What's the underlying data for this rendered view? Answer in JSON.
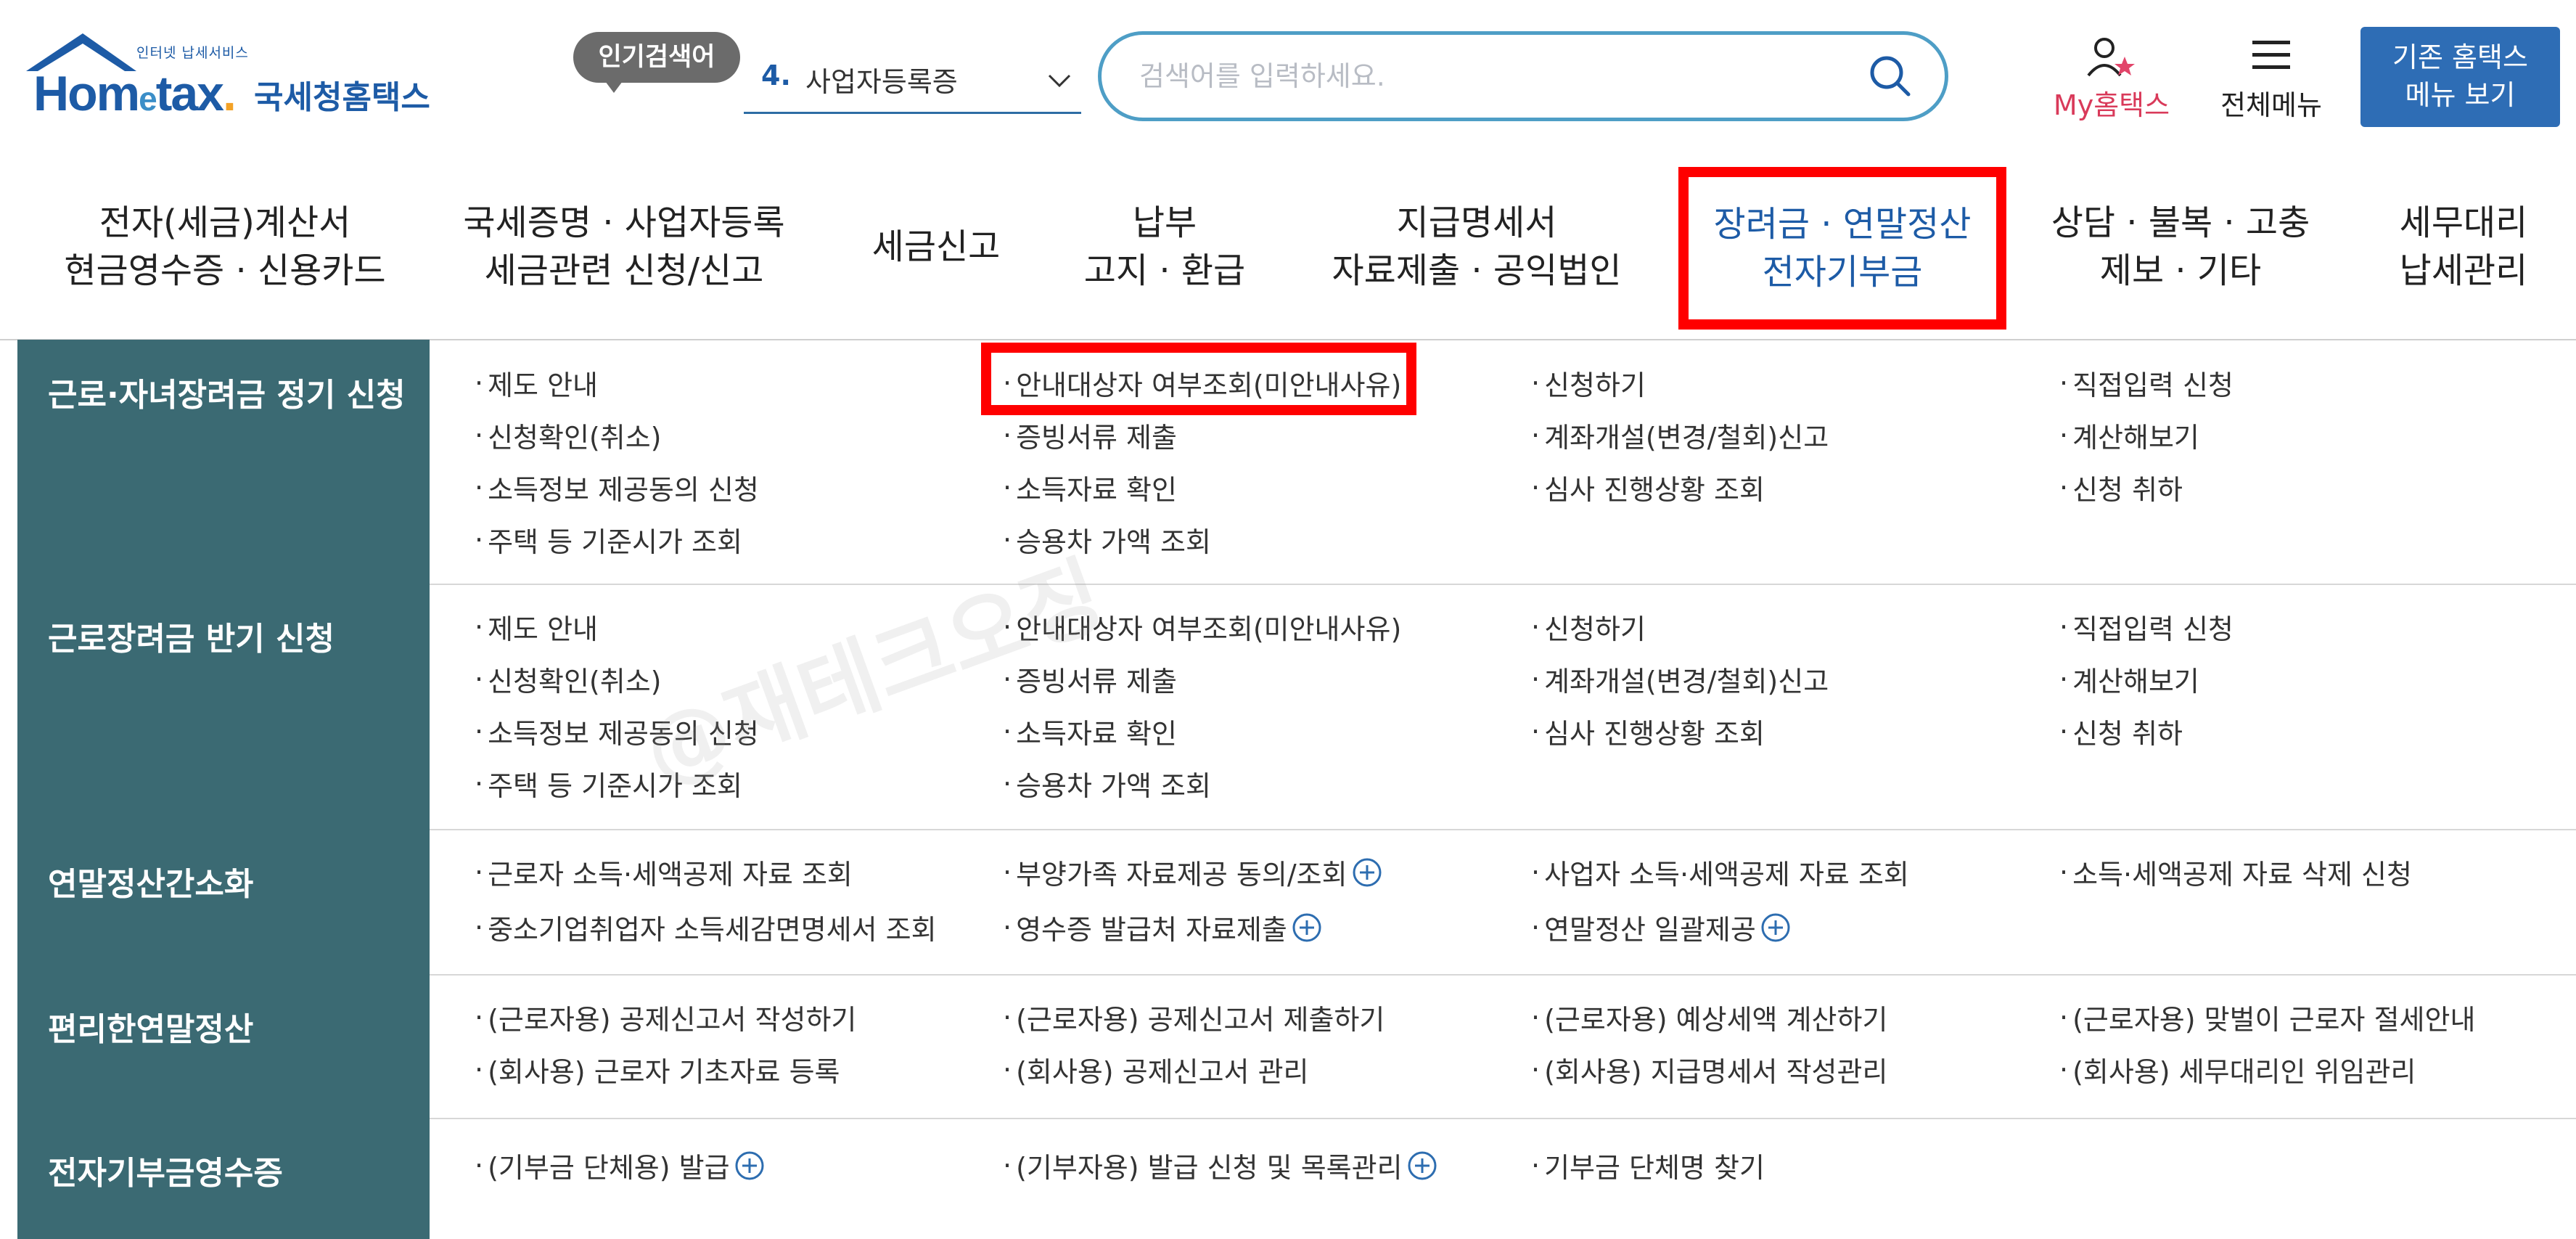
{
  "logo": {
    "tagline": "인터넷 납세서비스",
    "home_text": "Hom",
    "e_text": "e",
    "tax_text": "tax",
    "dot": ".",
    "service_name": "국세청홈택스"
  },
  "header": {
    "popular_badge": "인기검색어",
    "popular_rank": "4.",
    "popular_term": "사업자등록증",
    "search_placeholder": "검색어를 입력하세요.",
    "my_hometax": "My홈택스",
    "all_menu": "전체메뉴",
    "old_hometax_line1": "기존 홈택스",
    "old_hometax_line2": "메뉴 보기"
  },
  "nav": [
    {
      "line1": "전자(세금)계산서",
      "line2": "현금영수증 · 신용카드"
    },
    {
      "line1": "국세증명 · 사업자등록",
      "line2": "세금관련 신청/신고"
    },
    {
      "line1": "세금신고",
      "line2": ""
    },
    {
      "line1": "납부",
      "line2": "고지 · 환급"
    },
    {
      "line1": "지급명세서",
      "line2": "자료제출 · 공익법인"
    },
    {
      "line1": "장려금 · 연말정산",
      "line2": "전자기부금"
    },
    {
      "line1": "상담 · 불복 · 고충",
      "line2": "제보 · 기타"
    },
    {
      "line1": "세무대리",
      "line2": "납세관리"
    }
  ],
  "rows": [
    {
      "title": "근로·자녀장려금 정기 신청",
      "items": [
        [
          "제도 안내",
          "안내대상자 여부조회(미안내사유)",
          "신청하기",
          "직접입력 신청"
        ],
        [
          "신청확인(취소)",
          "증빙서류 제출",
          "계좌개설(변경/철회)신고",
          "계산해보기"
        ],
        [
          "소득정보 제공동의 신청",
          "소득자료 확인",
          "심사 진행상황 조회",
          "신청 취하"
        ],
        [
          "주택 등 기준시가 조회",
          "승용차 가액 조회",
          "",
          ""
        ]
      ]
    },
    {
      "title": "근로장려금 반기 신청",
      "items": [
        [
          "제도 안내",
          "안내대상자 여부조회(미안내사유)",
          "신청하기",
          "직접입력 신청"
        ],
        [
          "신청확인(취소)",
          "증빙서류 제출",
          "계좌개설(변경/철회)신고",
          "계산해보기"
        ],
        [
          "소득정보 제공동의 신청",
          "소득자료 확인",
          "심사 진행상황 조회",
          "신청 취하"
        ],
        [
          "주택 등 기준시가 조회",
          "승용차 가액 조회",
          "",
          ""
        ]
      ]
    },
    {
      "title": "연말정산간소화",
      "items": [
        [
          "근로자 소득·세액공제 자료 조회",
          "부양가족 자료제공 동의/조회",
          "사업자 소득·세액공제 자료 조회",
          "소득·세액공제 자료 삭제 신청"
        ],
        [
          "중소기업취업자 소득세감면명세서 조회",
          "영수증 발급처 자료제출",
          "연말정산 일괄제공",
          ""
        ]
      ]
    },
    {
      "title": "편리한연말정산",
      "items": [
        [
          "(근로자용) 공제신고서 작성하기",
          "(근로자용) 공제신고서 제출하기",
          "(근로자용) 예상세액 계산하기",
          "(근로자용) 맞벌이 근로자 절세안내"
        ],
        [
          "(회사용) 근로자 기초자료 등록",
          "(회사용) 공제신고서 관리",
          "(회사용) 지급명세서 작성관리",
          "(회사용) 세무대리인 위임관리"
        ]
      ]
    },
    {
      "title": "전자기부금영수증",
      "items": [
        [
          "(기부금 단체용) 발급",
          "(기부자용) 발급 신청 및 목록관리",
          "기부금 단체명 찾기",
          ""
        ]
      ]
    }
  ],
  "bullet": "·",
  "watermark": "@재테크오징"
}
